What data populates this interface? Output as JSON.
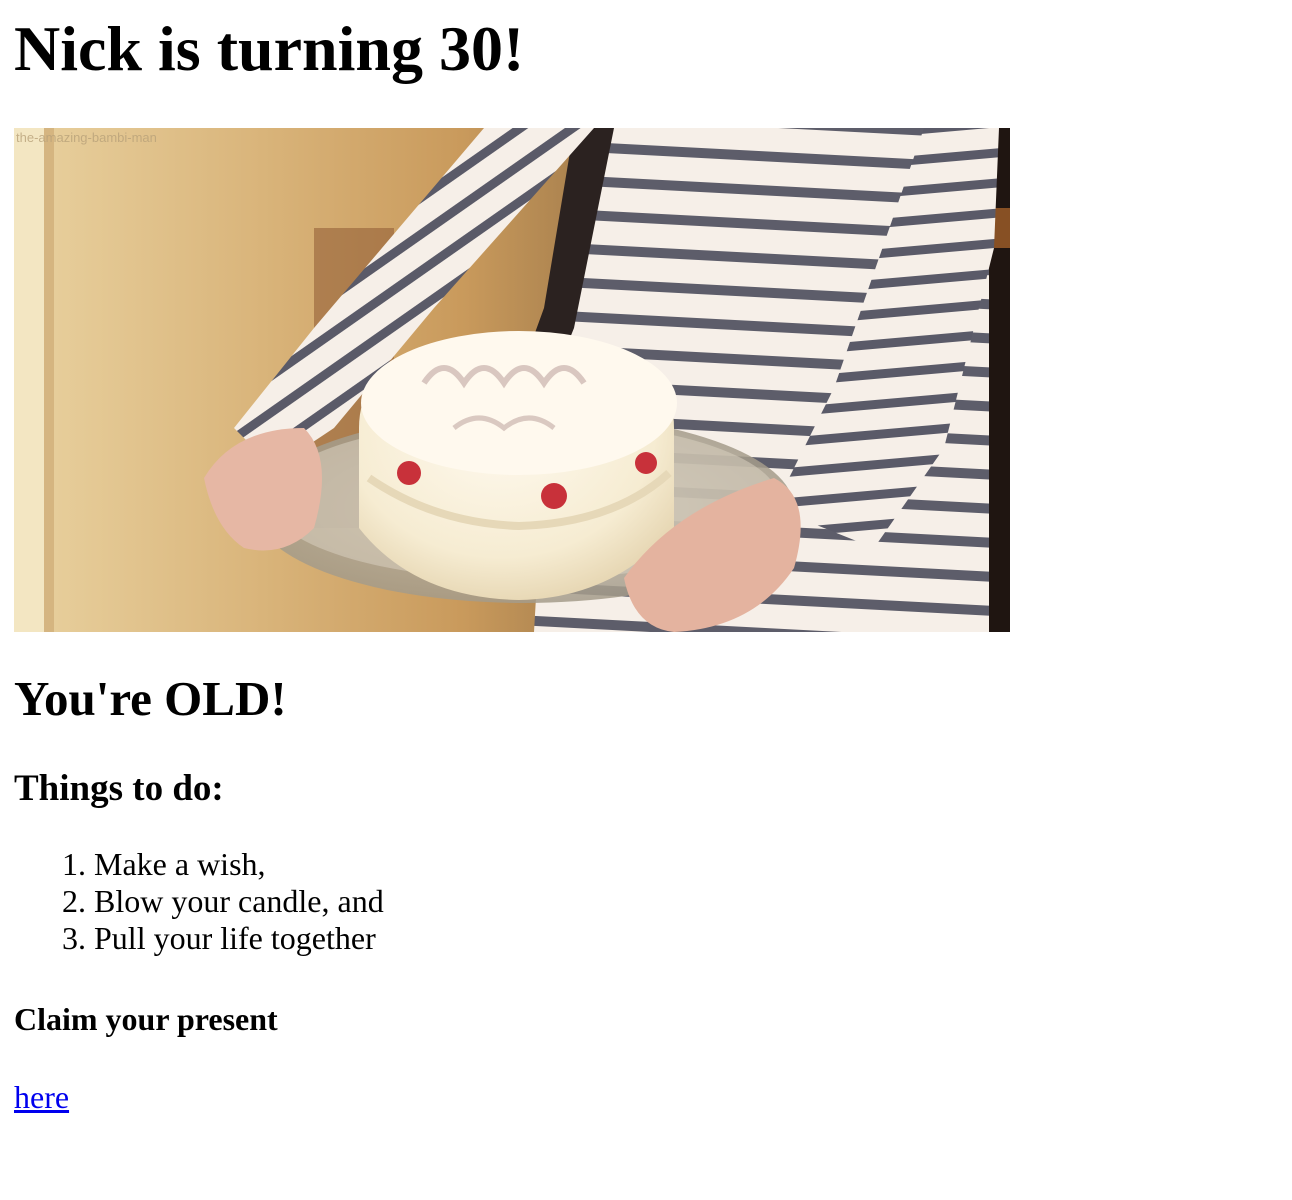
{
  "page": {
    "title": "Nick is turning 30!",
    "hero_image": {
      "alt": "",
      "watermark": "the-amazing-bambi-man"
    },
    "subtitle": "You're OLD!",
    "todo_heading": "Things to do:",
    "todo_items": [
      "Make a wish,",
      "Blow your candle, and",
      "Pull your life together"
    ],
    "present_heading": "Claim your present",
    "present_link_label": "here"
  },
  "colors": {
    "link": "#0000ee",
    "text": "#000000",
    "background": "#ffffff"
  }
}
